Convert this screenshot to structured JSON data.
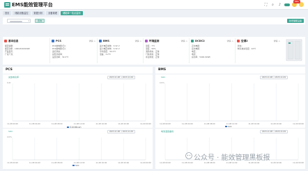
{
  "header": {
    "title": "EMS能效管理平台",
    "notification_count": "99+"
  },
  "tabs": [
    {
      "label": "首页",
      "active": false
    },
    {
      "label": "储能设备监控",
      "active": false
    },
    {
      "label": "数据分析",
      "active": false
    },
    {
      "label": "设备管理",
      "active": false
    },
    {
      "label": "储能单一站点监测",
      "active": true
    }
  ],
  "filter": {
    "query_label": "查询",
    "add_label": "新增储能设备"
  },
  "cards": [
    {
      "title": "基本信息",
      "color": "#e8514a",
      "detail": "",
      "lines": [
        "额定容量：",
        "额定功率：100kW/100kWh",
        "产品型号：",
        "厂商厂商："
      ]
    },
    {
      "title": "PCS",
      "color": "#3a75c4",
      "detail": "详情 >",
      "lines": [
        "PCS放电量(日)：",
        "PCS放电量(日)：",
        "运行状态：",
        "总有功功率：",
        "设定功率：32.2℃"
      ]
    },
    {
      "title": "BMS",
      "color": "#3a75c4",
      "detail": "详情 >",
      "lines": [
        "最大电压单体：3.32 V",
        "最小电压单体：3.32 V",
        "平均温度：32.2℃",
        "温差：3.2℃"
      ]
    },
    {
      "title": "环境监测",
      "color": "#b05dc9",
      "detail": "详情 >",
      "lines": [
        "温度：7℃",
        "湿度：50%",
        "消防状态：正常",
        "门禁状态：正常",
        "水浸状态：正常"
      ]
    },
    {
      "title": "DCDC2",
      "color": "#3a9e8a",
      "detail": "详情 >",
      "lines": [
        "正向电能：",
        "反向电能：",
        "电压：",
        "电流：",
        "总功率：5402.0kWh"
      ]
    },
    {
      "title": "空调2",
      "color": "#e8514a",
      "detail": "详情 >",
      "lines": [
        "状态：",
        "制冷启动温度：22℃"
      ]
    }
  ],
  "pcs_panel": {
    "title": "PCS",
    "sub1": {
      "label": "充放电功率",
      "date_start": "2023-11-08",
      "date_end": "2023-11-09",
      "y_top": "1kW",
      "legend": "有功功率(kW)"
    },
    "sub2": {
      "label": "SOC",
      "date_start": "2023-11-08",
      "date_end": "2023-11-09",
      "y_top": "100%",
      "legend": "SOC"
    }
  },
  "bms_panel": {
    "title": "BMS",
    "sub1": {
      "label": "SOC",
      "date_start": "2023-11-08",
      "date_end": "2023-11-09",
      "y_top": "100%",
      "legend": "SOC"
    },
    "sub2": {
      "label": "电池温度曲线",
      "date_start": "2023-11-08",
      "date_end": "2023-11-09",
      "y_top": "",
      "legend": ""
    }
  },
  "time_ticks": [
    "11-08 00:00",
    "11-08 04:00",
    "11-08 08:00",
    "11-08 12:00",
    "11-08 16:00",
    "11-08 20:00",
    "11-09 00:00"
  ],
  "watermark": "公众号 · 能效管理黑板报"
}
